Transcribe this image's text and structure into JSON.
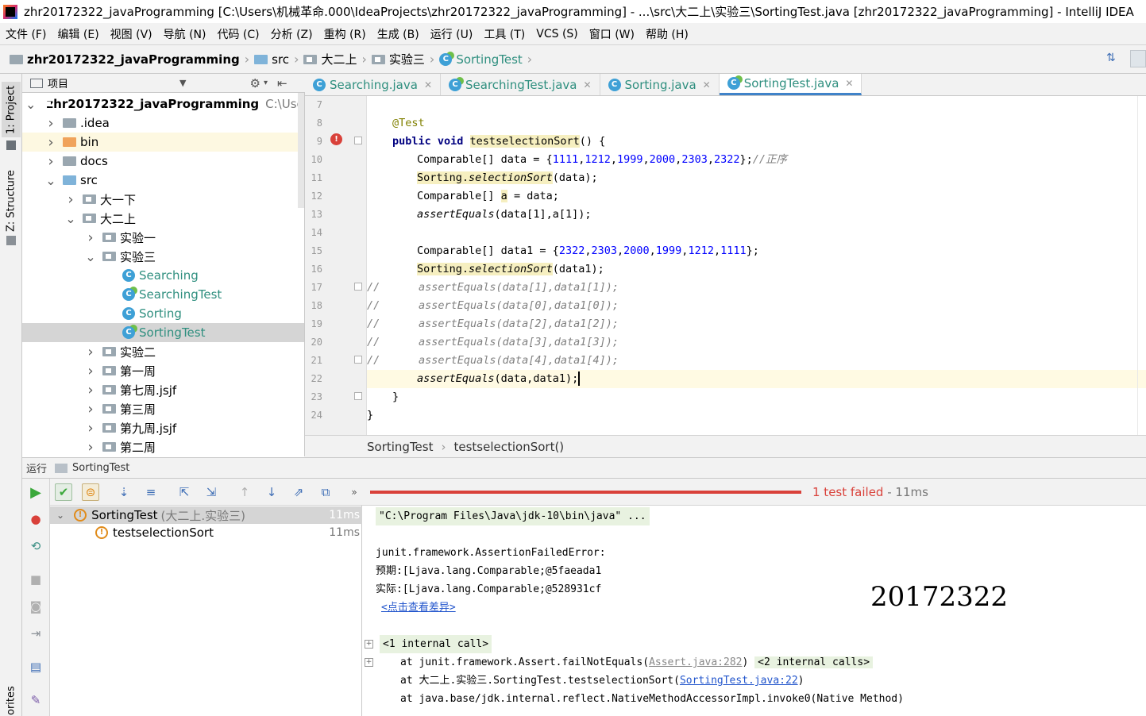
{
  "window": {
    "title": "zhr20172322_javaProgramming [C:\\Users\\机械革命.000\\IdeaProjects\\zhr20172322_javaProgramming] - ...\\src\\大二上\\实验三\\SortingTest.java [zhr20172322_javaProgramming] - IntelliJ IDEA"
  },
  "menu": [
    "文件 (F)",
    "编辑 (E)",
    "视图 (V)",
    "导航 (N)",
    "代码 (C)",
    "分析 (Z)",
    "重构 (R)",
    "生成 (B)",
    "运行 (U)",
    "工具 (T)",
    "VCS (S)",
    "窗口 (W)",
    "帮助 (H)"
  ],
  "breadcrumbs": [
    "zhr20172322_javaProgramming",
    "src",
    "大二上",
    "实验三",
    "SortingTest"
  ],
  "left_strip": {
    "project_tab": "1: Project",
    "structure_tab": "Z: Structure",
    "favorites_tab": "orites"
  },
  "project_panel": {
    "header": "项目",
    "tree": [
      {
        "label": "zhr20172322_javaProgramming",
        "hint": "C:\\Users",
        "kind": "module",
        "expanded": true
      },
      {
        "label": ".idea",
        "kind": "folder",
        "expanded": false
      },
      {
        "label": "bin",
        "kind": "folder-orange",
        "expanded": false
      },
      {
        "label": "docs",
        "kind": "folder",
        "expanded": false
      },
      {
        "label": "src",
        "kind": "folder-blue",
        "expanded": true
      },
      {
        "label": "大一下",
        "kind": "package",
        "expanded": false
      },
      {
        "label": "大二上",
        "kind": "package",
        "expanded": true
      },
      {
        "label": "实验一",
        "kind": "package",
        "expanded": false
      },
      {
        "label": "实验三",
        "kind": "package",
        "expanded": true
      },
      {
        "label": "Searching",
        "kind": "class"
      },
      {
        "label": "SearchingTest",
        "kind": "test-class"
      },
      {
        "label": "Sorting",
        "kind": "class"
      },
      {
        "label": "SortingTest",
        "kind": "test-class",
        "selected": true
      },
      {
        "label": "实验二",
        "kind": "package",
        "expanded": false
      },
      {
        "label": "第一周",
        "kind": "package",
        "expanded": false
      },
      {
        "label": "第七周.jsjf",
        "kind": "package",
        "expanded": false
      },
      {
        "label": "第三周",
        "kind": "package",
        "expanded": false
      },
      {
        "label": "第九周.jsjf",
        "kind": "package",
        "expanded": false
      },
      {
        "label": "第二周",
        "kind": "package",
        "expanded": false
      }
    ]
  },
  "editor_tabs": [
    {
      "label": "Searching.java",
      "active": false
    },
    {
      "label": "SearchingTest.java",
      "active": false
    },
    {
      "label": "Sorting.java",
      "active": false
    },
    {
      "label": "SortingTest.java",
      "active": true
    }
  ],
  "line_numbers": [
    "7",
    "8",
    "9",
    "10",
    "11",
    "12",
    "13",
    "14",
    "15",
    "16",
    "17",
    "18",
    "19",
    "20",
    "21",
    "22",
    "23",
    "24"
  ],
  "code": {
    "l8_annotation": "@Test",
    "l9_kw": "public void ",
    "l9_name": "testselectionSort",
    "l9_rest": "() {",
    "l10_a": "Comparable[] data = {",
    "l10_nums": [
      "1111",
      "1212",
      "1999",
      "2000",
      "2303",
      "2322"
    ],
    "l10_b": "};",
    "l10_comment": "//正序",
    "l11_cls": "Sorting.",
    "l11_method": "selectionSort",
    "l11_rest": "(data);",
    "l12_a": "Comparable[] ",
    "l12_var": "a",
    "l12_rest": " = data;",
    "l13_method": "assertEquals",
    "l13_rest": "(data[1],a[1]);",
    "l15_a": "Comparable[] data1 = {",
    "l15_nums": [
      "2322",
      "2303",
      "2000",
      "1999",
      "1212",
      "1111"
    ],
    "l15_b": "};",
    "l16_cls": "Sorting.",
    "l16_method": "selectionSort",
    "l16_rest": "(data1);",
    "l17": "//      assertEquals(data[1],data1[1]);",
    "l18": "//      assertEquals(data[0],data1[0]);",
    "l19": "//      assertEquals(data[2],data1[2]);",
    "l20": "//      assertEquals(data[3],data1[3]);",
    "l21": "//      assertEquals(data[4],data1[4]);",
    "l22_method": "assertEquals",
    "l22_rest": "(data,data1);",
    "l23": "}",
    "l24": "}"
  },
  "editor_breadcrumb": [
    "SortingTest",
    "testselectionSort()"
  ],
  "run_panel": {
    "header_label": "运行",
    "config_name": "SortingTest",
    "status_text": "1 test failed",
    "status_time": "- 11ms",
    "tree": [
      {
        "label": "SortingTest",
        "hint": "(大二上.实验三)",
        "time": "11ms"
      },
      {
        "label": "testselectionSort",
        "time": "11ms"
      }
    ]
  },
  "console": {
    "cmd": "\"C:\\Program Files\\Java\\jdk-10\\bin\\java\" ...",
    "error": "junit.framework.AssertionFailedError:",
    "expected_label": "预期:",
    "expected_value": "[Ljava.lang.Comparable;@5faeada1",
    "actual_label": "实际:",
    "actual_value": "[Ljava.lang.Comparable;@528931cf",
    "diff_link": "<点击查看差异>",
    "internal_call": "<1 internal call>",
    "trace1_a": "at junit.framework.Assert.failNotEquals(",
    "trace1_link": "Assert.java:282",
    "trace1_b": ")",
    "trace1_calls": "<2 internal calls>",
    "trace2_a": "at 大二上.实验三.SortingTest.testselectionSort(",
    "trace2_link": "SortingTest.java:22",
    "trace2_b": ")",
    "trace3": "at java.base/jdk.internal.reflect.NativeMethodAccessorImpl.invoke0(Native Method)",
    "student_id": "20172322"
  }
}
